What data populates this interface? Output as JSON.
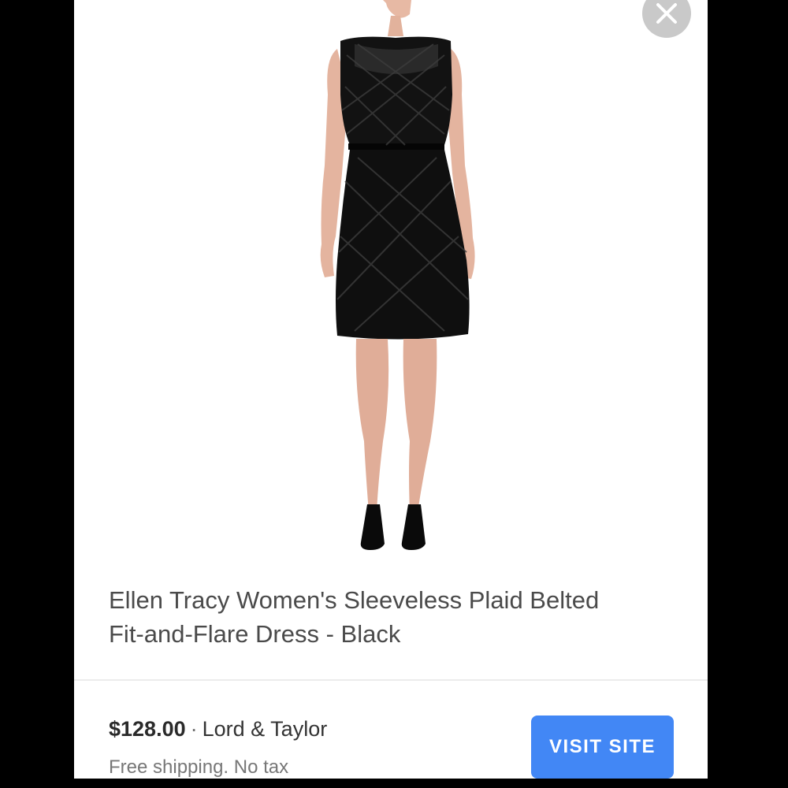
{
  "product": {
    "title_line1": "Ellen Tracy Women's Sleeveless Plaid Belted",
    "title_line2": "Fit-and-Flare Dress - Black",
    "price": "$128.00",
    "separator": "·",
    "store": "Lord & Taylor",
    "shipping": "Free shipping. No tax"
  },
  "actions": {
    "visit_label": "VISIT SITE",
    "close_icon": "close-icon"
  },
  "colors": {
    "accent": "#4287f5",
    "close_bg": "#c9c9c9",
    "frame": "#000000"
  }
}
